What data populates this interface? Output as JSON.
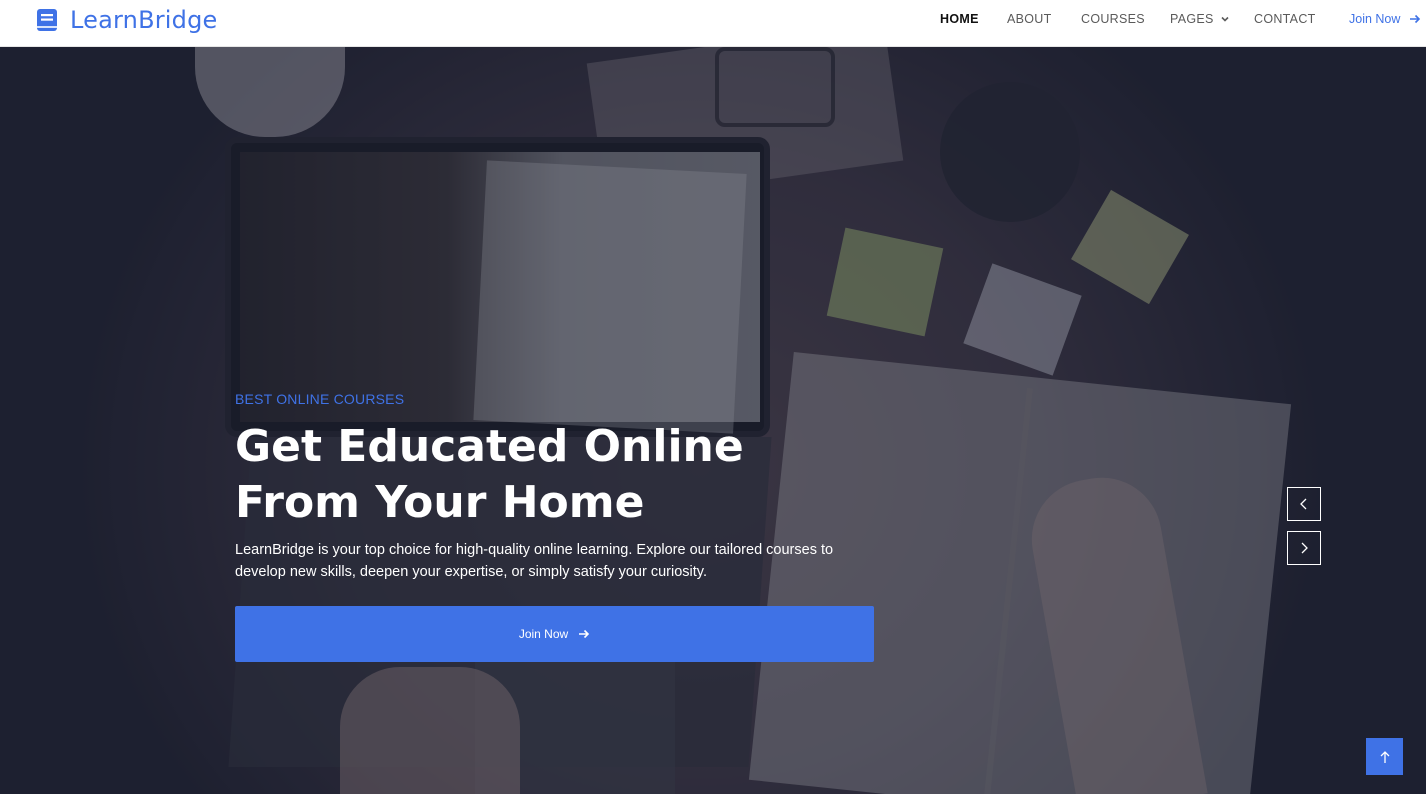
{
  "brand": {
    "name": "LearnBridge",
    "icon": "book-icon",
    "color": "#3f72e6"
  },
  "nav": {
    "items": [
      {
        "label": "HOME",
        "active": true
      },
      {
        "label": "ABOUT",
        "active": false
      },
      {
        "label": "COURSES",
        "active": false
      },
      {
        "label": "PAGES",
        "active": false,
        "icon": "chevron-down-icon"
      },
      {
        "label": "CONTACT",
        "active": false
      }
    ],
    "join_label": "Join Now",
    "join_icon": "arrow-right-icon"
  },
  "hero": {
    "subtitle": "BEST ONLINE COURSES",
    "title": "Get Educated Online From Your Home",
    "description": "LearnBridge is your top choice for high-quality online learning. Explore our tailored courses to develop new skills, deepen your expertise, or simply satisfy your curiosity.",
    "cta_label": "Join Now",
    "cta_icon": "arrow-right-icon",
    "carousel_prev_icon": "chevron-left-icon",
    "carousel_next_icon": "chevron-right-icon"
  },
  "back_to_top_icon": "arrow-up-icon",
  "colors": {
    "accent": "#3f72e6",
    "overlay": "#141830"
  }
}
